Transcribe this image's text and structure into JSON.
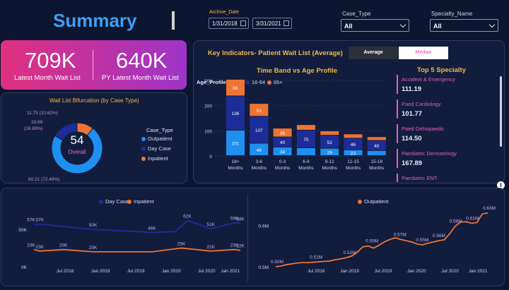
{
  "header": {
    "title": "Summary"
  },
  "filters": {
    "archive_label": "Archive_Date",
    "date_from": "1/31/2018",
    "date_to": "3/31/2021",
    "case_type_label": "Case_Type",
    "case_type_value": "All",
    "specialty_label": "Specialty_Name",
    "specialty_value": "All"
  },
  "kpi": {
    "latest_value": "709K",
    "latest_label": "Latest Month Wait List",
    "py_value": "640K",
    "py_label": "PY Latest Month Wait List"
  },
  "donut": {
    "title": "Wait List Bifurcation (by Case Type)",
    "center_value": "54",
    "center_label": "Overall",
    "slices": [
      {
        "name": "Outpatient",
        "value": 80.21,
        "pct": "72.49%",
        "label": "80.21 (72.49%)",
        "color": "#1f8ff0"
      },
      {
        "name": "Day Case",
        "value": 18.69,
        "pct": "16.89%",
        "label": "18.69 (16.89%)",
        "color": "#1c2d99"
      },
      {
        "name": "Inpatient",
        "value": 11.75,
        "pct": "10.62%",
        "label": "11.75 (10.62%)",
        "color": "#ee7433"
      }
    ],
    "legend_title": "Case_Type",
    "label_top": "11.75 (10.62%)",
    "label_mid1": "18.69",
    "label_mid2": "(16.89%)",
    "label_bottom": "80.21 (72.49%)"
  },
  "key_indicators": {
    "title": "Key Indicators- Patient Wait List (Average)",
    "btn_average": "Average",
    "btn_median": "Median"
  },
  "bands": {
    "title": "Time Band vs Age Profile",
    "legend_title": "Age_Profile",
    "legend": [
      {
        "name": "0-15",
        "color": "#1f8ff0"
      },
      {
        "name": "16-64",
        "color": "#1c2d99"
      },
      {
        "name": "65+",
        "color": "#ee7433"
      }
    ]
  },
  "chart_data": [
    {
      "type": "bar",
      "title": "Time Band vs Age Profile",
      "stacked": true,
      "categories": [
        "18+ Months",
        "3-6 Months",
        "0-3 Months",
        "6-9 Months",
        "9-12 Months",
        "12-15 Months",
        "15-18 Months"
      ],
      "series": [
        {
          "name": "0-15",
          "values": [
            101,
            49,
            34,
            31,
            29,
            23,
            20
          ],
          "labels": [
            "101",
            "49",
            "34",
            "",
            "29",
            "23",
            ""
          ]
        },
        {
          "name": "16-64",
          "values": [
            136,
            107,
            40,
            70,
            52,
            46,
            40
          ],
          "labels": [
            "136",
            "107",
            "40",
            "70",
            "52",
            "46",
            "40"
          ]
        },
        {
          "name": "65+",
          "values": [
            66,
            51,
            35,
            22,
            17,
            17,
            15
          ],
          "labels": [
            "66",
            "51",
            "35",
            "",
            "",
            "",
            ""
          ]
        }
      ],
      "ylim": [
        0,
        300
      ],
      "yticks": [
        "0",
        "100",
        "200",
        "300"
      ]
    },
    {
      "type": "line",
      "series": [
        {
          "name": "Day Case",
          "color": "#1c2d99"
        },
        {
          "name": "Inpatient",
          "color": "#ee7433"
        }
      ],
      "xticks": [
        "Jul 2018",
        "Jan 2019",
        "Jul 2019",
        "Jan 2020",
        "Jul 2020",
        "Jan 2021"
      ],
      "yticks": [
        "0K",
        "50K"
      ],
      "ylim": [
        0,
        70000
      ],
      "day_case_points": [
        [
          0,
          57
        ],
        [
          1,
          57
        ],
        [
          10,
          50
        ],
        [
          20,
          46
        ],
        [
          24,
          47
        ],
        [
          26,
          62
        ],
        [
          30,
          51
        ],
        [
          34,
          59
        ],
        [
          35,
          58
        ]
      ],
      "inpatient_points": [
        [
          0,
          23
        ],
        [
          1,
          21
        ],
        [
          5,
          23
        ],
        [
          10,
          20
        ],
        [
          20,
          20
        ],
        [
          25,
          25
        ],
        [
          30,
          21
        ],
        [
          34,
          23
        ],
        [
          35,
          22
        ]
      ],
      "day_case_labels": [
        "57K",
        "57K",
        "50K",
        "46K",
        "62K",
        "51K",
        "59K",
        "58K"
      ],
      "inpatient_labels": [
        "23K",
        "23K",
        "20K",
        "20K",
        "25K",
        "21K",
        "23K",
        "22K"
      ]
    },
    {
      "type": "line",
      "series": [
        {
          "name": "Outpatient",
          "color": "#ee7433"
        }
      ],
      "xticks": [
        "Jul 2018",
        "Jan 2019",
        "Jul 2019",
        "Jan 2020",
        "Jul 2020",
        "Jan 2021"
      ],
      "yticks": [
        "0.5M",
        "0.6M"
      ],
      "labels": [
        "0.50M",
        "0.51M",
        "0.52M",
        "0.55M",
        "0.57M",
        "0.55M",
        "0.56M",
        "0.58M",
        "0.61M",
        "0.63M"
      ]
    }
  ],
  "top_specialty": {
    "title": "Top 5 Specialty",
    "items": [
      {
        "name": "Accident & Emergency",
        "value": "111.19"
      },
      {
        "name": "Paed Cardiology",
        "value": "101.77"
      },
      {
        "name": "Paed Orthopaedic",
        "value": "114.50"
      },
      {
        "name": "Paediatric Dermatology",
        "value": "167.89"
      },
      {
        "name": "Paediatric ENT",
        "value": ""
      }
    ]
  },
  "line_left": {
    "legend": [
      {
        "name": "Day Case",
        "color": "#1c2d99"
      },
      {
        "name": "Inpatient",
        "color": "#ee7433"
      }
    ]
  },
  "line_right": {
    "legend": [
      {
        "name": "Outpatient",
        "color": "#ee7433"
      }
    ]
  },
  "info_icon": "info-icon"
}
